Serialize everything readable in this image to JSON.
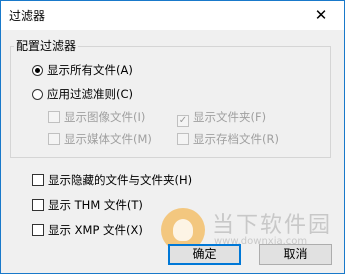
{
  "window": {
    "title": "过滤器",
    "close_glyph": "✕"
  },
  "group": {
    "label": "配置过滤器"
  },
  "options": {
    "show_all": "显示所有文件(A)",
    "apply_filter": "应用过滤准则(C)",
    "show_images": "显示图像文件(I)",
    "show_folders": "显示文件夹(F)",
    "show_media": "显示媒体文件(M)",
    "show_archives": "显示存档文件(R)",
    "show_hidden": "显示隐藏的文件与文件夹(H)",
    "show_thm": "显示 THM 文件(T)",
    "show_xmp": "显示 XMP 文件(X)"
  },
  "state": {
    "show_all_selected": true,
    "apply_filter_selected": false,
    "show_images_checked": false,
    "show_folders_checked": true,
    "show_media_checked": false,
    "show_archives_checked": false,
    "show_hidden_checked": false,
    "show_thm_checked": false,
    "show_xmp_checked": false
  },
  "buttons": {
    "ok": "确定",
    "cancel": "取消"
  },
  "watermark": {
    "text": "当下软件园",
    "url": "www.downxia.com"
  }
}
